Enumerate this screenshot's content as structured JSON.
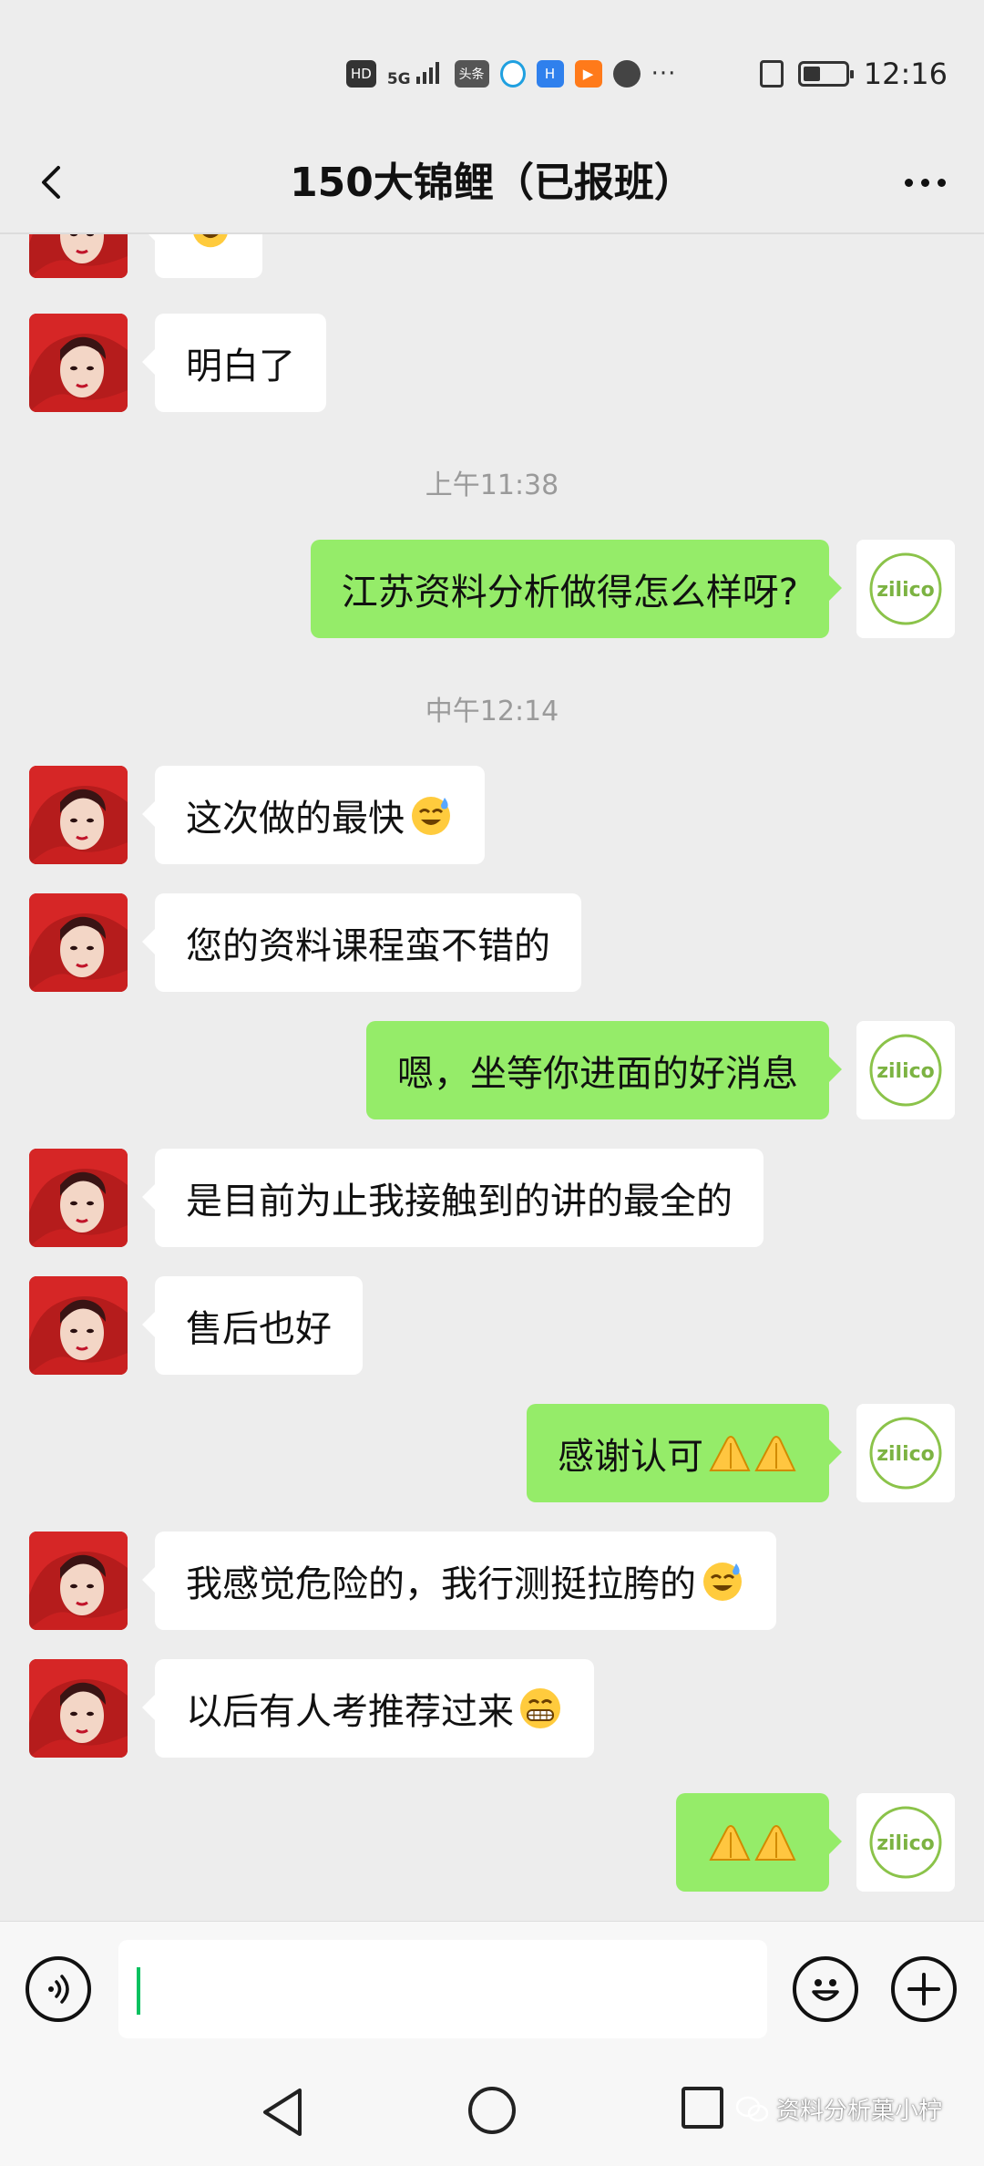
{
  "status_bar": {
    "hd": "HD",
    "signal": "5G",
    "app_badge": "头条",
    "time": "12:16",
    "battery_level": 0.4,
    "more_indicator": "···"
  },
  "header": {
    "title": "150大锦鲤（已报班）",
    "back_icon": "chevron-left-icon",
    "more_icon": "more-dots-icon"
  },
  "timestamps": [
    "上午11:38",
    "中午12:14"
  ],
  "messages": [
    {
      "side": "in",
      "text": "",
      "emoji": "sweat-smile"
    },
    {
      "side": "in",
      "text": "明白了"
    },
    {
      "side": "out",
      "text": "江苏资料分析做得怎么样呀?"
    },
    {
      "side": "in",
      "text": "这次做的最快",
      "emoji": "sweat-smile"
    },
    {
      "side": "in",
      "text": "您的资料课程蛮不错的"
    },
    {
      "side": "out",
      "text": "嗯，坐等你进面的好消息"
    },
    {
      "side": "in",
      "text": "是目前为止我接触到的讲的最全的"
    },
    {
      "side": "in",
      "text": "售后也好"
    },
    {
      "side": "out",
      "text": "感谢认可",
      "emoji": "praying-hands-x2"
    },
    {
      "side": "in",
      "text": "我感觉危险的，我行测挺拉胯的",
      "emoji": "sweat-smile"
    },
    {
      "side": "in",
      "text": "以后有人考推荐过来",
      "emoji": "grin"
    },
    {
      "side": "out",
      "text": "",
      "emoji": "praying-hands-x2"
    }
  ],
  "my_avatar_logo": "zilico",
  "input_bar": {
    "voice_icon": "voice-icon",
    "emoji_icon": "smiley-icon",
    "plus_icon": "plus-icon",
    "value": ""
  },
  "nav_bar": {
    "back_icon": "triangle-back-icon",
    "home_icon": "circle-home-icon",
    "recent_icon": "square-recent-icon"
  },
  "watermark": "资料分析菓小柠",
  "colors": {
    "background": "#ededed",
    "outgoing_bubble": "#95ec69",
    "incoming_bubble": "#ffffff",
    "accent_caret": "#07c160",
    "logo_green": "#7cb342"
  }
}
